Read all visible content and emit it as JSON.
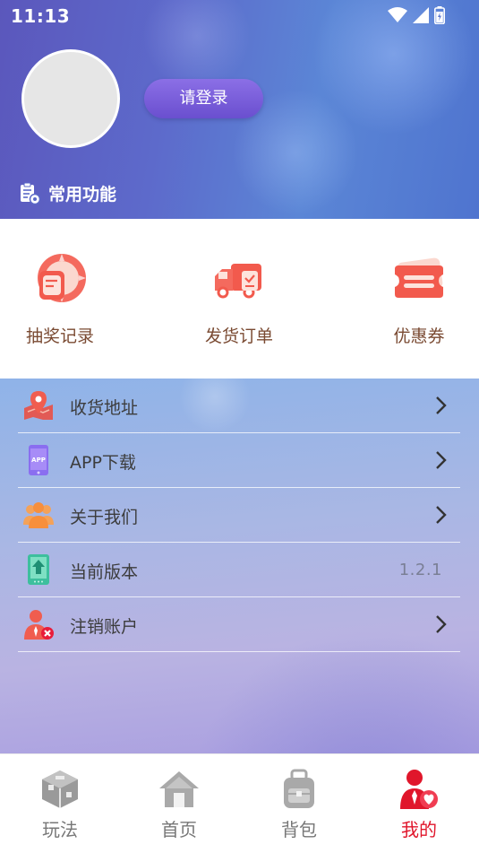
{
  "status_bar": {
    "time": "11:13"
  },
  "header": {
    "login_label": "请登录",
    "section_title": "常用功能"
  },
  "quick_functions": [
    {
      "label": "抽奖记录",
      "icon": "lottery-record-icon"
    },
    {
      "label": "发货订单",
      "icon": "shipping-truck-icon"
    },
    {
      "label": "优惠券",
      "icon": "coupon-icon"
    }
  ],
  "menu": [
    {
      "label": "收货地址",
      "icon": "location-map-icon"
    },
    {
      "label": "APP下载",
      "icon": "app-download-icon",
      "icon_text": "APP"
    },
    {
      "label": "关于我们",
      "icon": "people-group-icon"
    },
    {
      "label": "当前版本",
      "icon": "version-update-icon",
      "value": "1.2.1"
    },
    {
      "label": "注销账户",
      "icon": "delete-account-icon"
    }
  ],
  "bottom_nav": [
    {
      "label": "玩法",
      "icon": "cube-icon",
      "active": false
    },
    {
      "label": "首页",
      "icon": "home-icon",
      "active": false
    },
    {
      "label": "背包",
      "icon": "backpack-icon",
      "active": false
    },
    {
      "label": "我的",
      "icon": "profile-icon",
      "active": true
    }
  ],
  "colors": {
    "accent_active": "#e0162b",
    "login_button": "#7a5fdb",
    "quick_label": "#7a4a32"
  }
}
